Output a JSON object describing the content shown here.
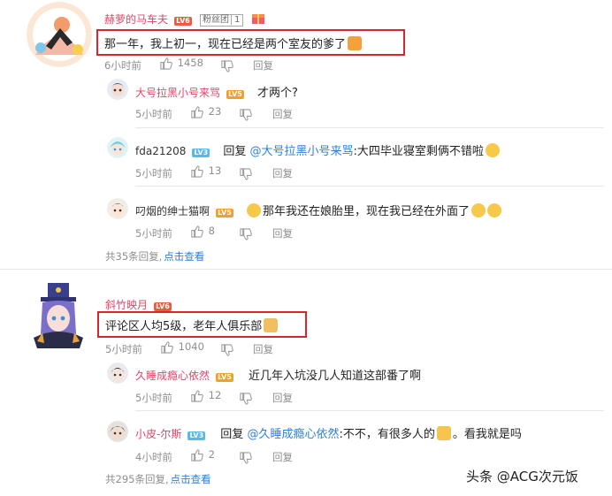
{
  "c1": {
    "username": "赫萝的马车夫",
    "level": "LV6",
    "fan_badge": "粉丝团",
    "fan_level": "1",
    "text": "那一年，我上初一，现在已经是两个室友的爹了",
    "time": "6小时前",
    "likes": "1458",
    "reply": "回复"
  },
  "r1": {
    "username": "大号拉黑小号来骂",
    "level": "LV5",
    "text": "才两个?",
    "time": "5小时前",
    "likes": "23",
    "reply": "回复"
  },
  "r2": {
    "username": "fda21208",
    "level": "LV3",
    "reply_prefix": "回复",
    "mention": "@大号拉黑小号来骂",
    "text": ":大四毕业寝室剩俩不错啦",
    "time": "5小时前",
    "likes": "13",
    "reply": "回复"
  },
  "r3": {
    "username": "叼烟的绅士猫啊",
    "level": "LV5",
    "text": "那年我还在娘胎里，现在我已经在外面了",
    "time": "5小时前",
    "likes": "8",
    "reply": "回复"
  },
  "more1": {
    "count_text": "共35条回复,",
    "action": "点击查看"
  },
  "c2": {
    "username": "斜竹映月",
    "level": "LV6",
    "text": "评论区人均5级，老年人俱乐部",
    "time": "5小时前",
    "likes": "1040",
    "reply": "回复"
  },
  "r4": {
    "username": "久睡成瘾心依然",
    "level": "LV5",
    "text": "近几年入坑没几人知道这部番了啊",
    "time": "5小时前",
    "likes": "12",
    "reply": "回复"
  },
  "r5": {
    "username": "小皮-尔斯",
    "level": "LV3",
    "reply_prefix": "回复",
    "mention": "@久睡成瘾心依然",
    "text": ":不不，有很多人的",
    "text_after": "。看我就是吗",
    "time": "4小时前",
    "likes": "2",
    "reply": "回复"
  },
  "more2": {
    "count_text": "共295条回复,",
    "action": "点击查看"
  },
  "watermark": "头条 @ACG次元饭",
  "colors": {
    "username": "#e0466a",
    "link": "#2e7fd8",
    "highlight": "#d7262d",
    "meta": "#8e8e8e"
  },
  "icons": [
    "thumb-up-icon",
    "thumb-down-icon",
    "fire-emoji",
    "crying-emoji",
    "sweat-emoji",
    "cat-emoji",
    "doge-emoji"
  ]
}
